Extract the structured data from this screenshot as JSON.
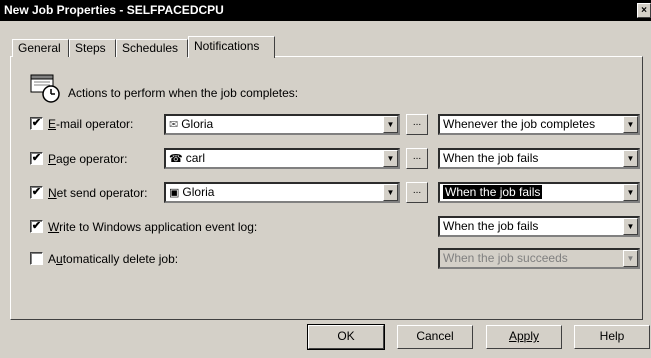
{
  "window": {
    "title": "New Job Properties - SELFPACEDCPU",
    "close": "×"
  },
  "tabs": [
    {
      "label": "General"
    },
    {
      "label": "Steps"
    },
    {
      "label": "Schedules"
    },
    {
      "label": "Notifications"
    }
  ],
  "header": {
    "text": "Actions to perform when the job completes:",
    "icon": "calendar-clock-icon"
  },
  "rows": {
    "email": {
      "checked": true,
      "label_pre": "",
      "label_u": "E",
      "label_post": "-mail operator:",
      "operator": "Gloria",
      "operator_icon": "envelope-icon",
      "when": "Whenever the job completes"
    },
    "page": {
      "checked": true,
      "label_pre": "",
      "label_u": "P",
      "label_post": "age operator:",
      "operator": "carl",
      "operator_icon": "phone-icon",
      "when": "When the job fails"
    },
    "netsend": {
      "checked": true,
      "label_pre": "",
      "label_u": "N",
      "label_post": "et send operator:",
      "operator": "Gloria",
      "operator_icon": "computer-icon",
      "when": "When the job fails"
    },
    "eventlog": {
      "checked": true,
      "label_pre": "",
      "label_u": "W",
      "label_post": "rite to Windows application event log:",
      "when": "When the job fails"
    },
    "delete": {
      "checked": false,
      "label_pre": "A",
      "label_u": "u",
      "label_post": "tomatically delete job:",
      "when": "When the job succeeds"
    }
  },
  "ellipsis": "...",
  "check": "✔",
  "buttons": {
    "ok": "OK",
    "cancel": "Cancel",
    "apply": "Apply",
    "help": "Help"
  }
}
